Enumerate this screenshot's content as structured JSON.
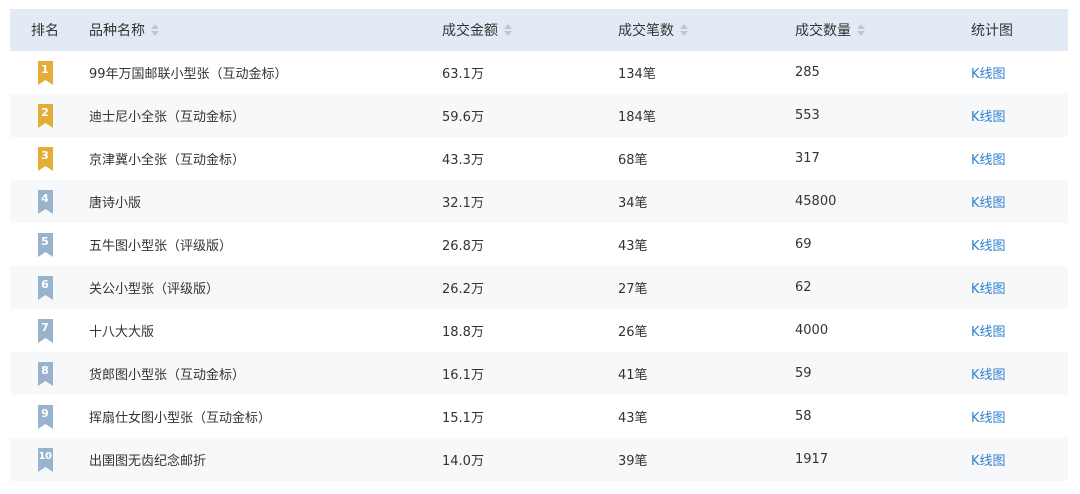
{
  "header": {
    "rank": "排名",
    "name": "品种名称",
    "amount": "成交金额",
    "count": "成交笔数",
    "qty": "成交数量",
    "chart": "统计图"
  },
  "colors": {
    "gold": "#e5ac38",
    "blue": "#9ab3cc",
    "link": "#2f7fd0",
    "header_bg": "#e2ebf5"
  },
  "rows": [
    {
      "rank": "1",
      "name": "99年万国邮联小型张（互动金标）",
      "amount": "63.1万",
      "count": "134笔",
      "qty": "285",
      "chart": "K线图",
      "medal": "gold"
    },
    {
      "rank": "2",
      "name": "迪士尼小全张（互动金标）",
      "amount": "59.6万",
      "count": "184笔",
      "qty": "553",
      "chart": "K线图",
      "medal": "gold"
    },
    {
      "rank": "3",
      "name": "京津冀小全张（互动金标）",
      "amount": "43.3万",
      "count": "68笔",
      "qty": "317",
      "chart": "K线图",
      "medal": "gold"
    },
    {
      "rank": "4",
      "name": "唐诗小版",
      "amount": "32.1万",
      "count": "34笔",
      "qty": "45800",
      "chart": "K线图",
      "medal": "blue"
    },
    {
      "rank": "5",
      "name": "五牛图小型张（评级版）",
      "amount": "26.8万",
      "count": "43笔",
      "qty": "69",
      "chart": "K线图",
      "medal": "blue"
    },
    {
      "rank": "6",
      "name": "关公小型张（评级版）",
      "amount": "26.2万",
      "count": "27笔",
      "qty": "62",
      "chart": "K线图",
      "medal": "blue"
    },
    {
      "rank": "7",
      "name": "十八大大版",
      "amount": "18.8万",
      "count": "26笔",
      "qty": "4000",
      "chart": "K线图",
      "medal": "blue"
    },
    {
      "rank": "8",
      "name": "货郎图小型张（互动金标）",
      "amount": "16.1万",
      "count": "41笔",
      "qty": "59",
      "chart": "K线图",
      "medal": "blue"
    },
    {
      "rank": "9",
      "name": "挥扇仕女图小型张（互动金标）",
      "amount": "15.1万",
      "count": "43笔",
      "qty": "58",
      "chart": "K线图",
      "medal": "blue"
    },
    {
      "rank": "10",
      "name": "出圉图无齿纪念邮折",
      "amount": "14.0万",
      "count": "39笔",
      "qty": "1917",
      "chart": "K线图",
      "medal": "blue"
    }
  ]
}
